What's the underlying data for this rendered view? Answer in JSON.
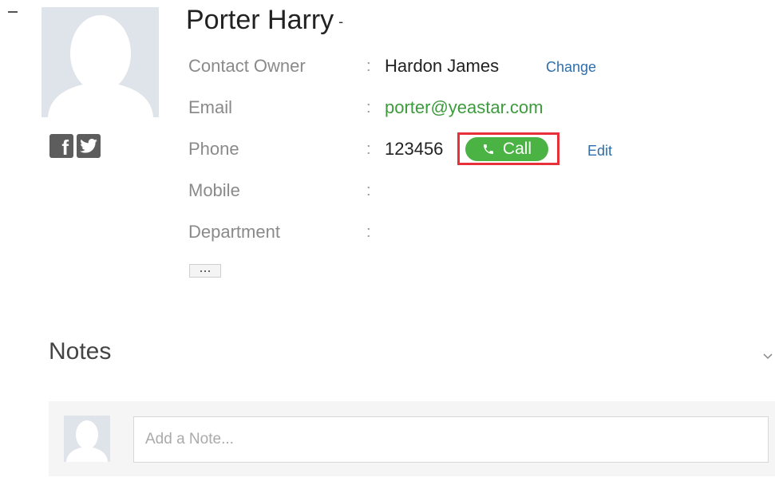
{
  "contact": {
    "name": "Porter Harry",
    "name_suffix": "-",
    "social": [
      {
        "icon": "facebook-icon",
        "glyph": "f"
      },
      {
        "icon": "twitter-icon",
        "glyph": "bird"
      }
    ]
  },
  "fields": {
    "owner": {
      "label": "Contact Owner",
      "colon": ":",
      "value": "Hardon James",
      "action": "Change"
    },
    "email": {
      "label": "Email",
      "colon": ":",
      "value": "porter@yeastar.com"
    },
    "phone": {
      "label": "Phone",
      "colon": ":",
      "value": "123456",
      "call_label": "Call",
      "action": "Edit"
    },
    "mobile": {
      "label": "Mobile",
      "colon": ":",
      "value": ""
    },
    "department": {
      "label": "Department",
      "colon": ":",
      "value": ""
    }
  },
  "notes": {
    "title": "Notes",
    "placeholder": "Add a Note...",
    "input_value": ""
  },
  "colors": {
    "call_button": "#4ab344",
    "call_highlight": "#e8303a",
    "link": "#2f6ea8",
    "email": "#3e9a3e",
    "avatar_bg": "#dfe3ea"
  }
}
